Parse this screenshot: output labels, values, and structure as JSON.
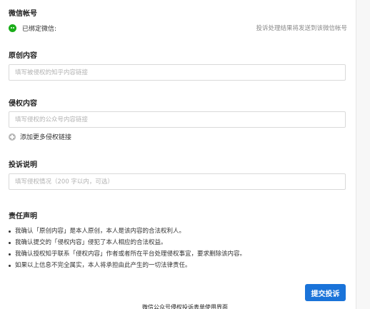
{
  "wechat": {
    "title": "微信帐号",
    "icon": "wechat-icon",
    "bound_label": "已绑定微信:",
    "notice": "投诉处理结果将发送到该微信帐号"
  },
  "original": {
    "title": "原创内容",
    "placeholder": "填写被侵权的知乎内容链接"
  },
  "infringing": {
    "title": "侵权内容",
    "placeholder": "填写侵权的公众号内容链接",
    "add_more": "添加更多侵权链接"
  },
  "description": {
    "title": "投诉说明",
    "placeholder": "填写侵权情况（200 字以内，可选）"
  },
  "responsibility": {
    "title": "责任声明",
    "items": [
      "我确认「原创内容」是本人原创，本人是该内容的合法权利人。",
      "我确认提交的「侵权内容」侵犯了本人相应的合法权益。",
      "我确认授权知乎联系「侵权内容」作者或者所在平台处理侵权事宜，要求删除该内容。",
      "如果以上信息不完全属实，本人将承担由此产生的一切法律责任。"
    ]
  },
  "submit_label": "提交投诉",
  "caption": "微信公众号侵权投诉表单使用界面",
  "colors": {
    "accent": "#1a73d9",
    "wechat_green": "#1aad19"
  }
}
